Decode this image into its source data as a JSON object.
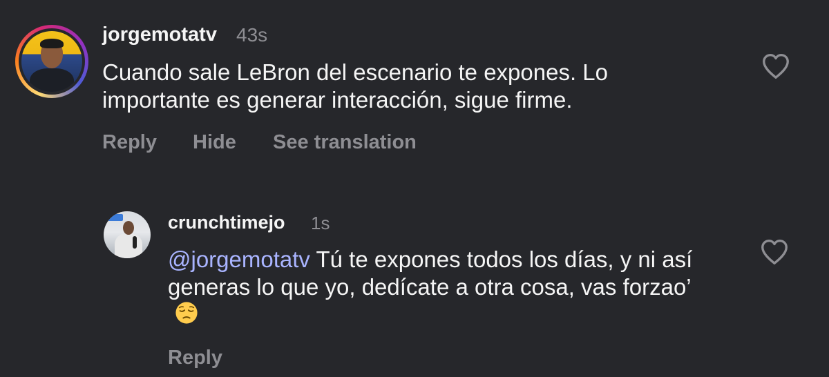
{
  "comments": [
    {
      "username": "jorgemotatv",
      "time": "43s",
      "text": "Cuando sale LeBron del escenario te expones. Lo importante es generar interacción, sigue firme.",
      "actions": {
        "reply": "Reply",
        "hide": "Hide",
        "translate": "See translation"
      },
      "avatar_story_ring": true
    },
    {
      "username": "crunchtimejo",
      "time": "1s",
      "mention": "@jorgemotatv",
      "text": " Tú te expones todos los días, y ni así generas lo que yo, dedícate a otra cosa, vas forzao’",
      "emoji": "pensive-face",
      "actions": {
        "reply": "Reply"
      }
    }
  ],
  "colors": {
    "background": "#26272b",
    "primary_text": "#f5f5f5",
    "secondary_text": "#8e8e93",
    "mention": "#a9b4ff"
  }
}
